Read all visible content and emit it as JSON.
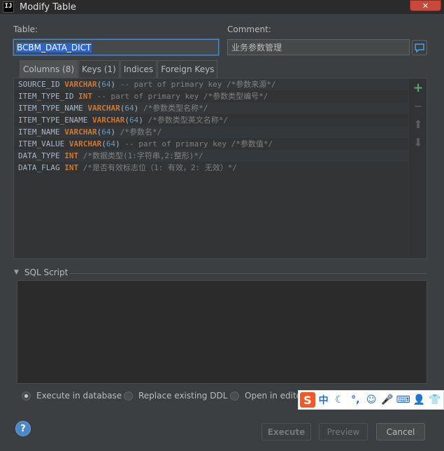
{
  "window": {
    "title": "Modify Table",
    "app_icon": "IJ",
    "close_glyph": "✕"
  },
  "table": {
    "label": "Table:",
    "value": "BCBM_DATA_DICT"
  },
  "comment": {
    "label": "Comment:",
    "value": "业务参数管理"
  },
  "tabs": [
    {
      "label": "Columns (8)"
    },
    {
      "label": "Keys (1)"
    },
    {
      "label": "Indices"
    },
    {
      "label": "Foreign Keys"
    }
  ],
  "columns": [
    {
      "name": "SOURCE_ID",
      "type": "VARCHAR",
      "size": "64",
      "extra": "-- part of primary key",
      "comment": "/*参数来源*/"
    },
    {
      "name": "ITEM_TYPE_ID",
      "type": "INT",
      "size": "",
      "extra": "-- part of primary key",
      "comment": "/*参数类型编号*/"
    },
    {
      "name": "ITEM_TYPE_NAME",
      "type": "VARCHAR",
      "size": "64",
      "extra": "",
      "comment": "/*参数类型名称*/"
    },
    {
      "name": "ITEM_TYPE_ENAME",
      "type": "VARCHAR",
      "size": "64",
      "extra": "",
      "comment": "/*参数类型英文名称*/"
    },
    {
      "name": "ITEM_NAME",
      "type": "VARCHAR",
      "size": "64",
      "extra": "",
      "comment": "/*参数名*/"
    },
    {
      "name": "ITEM_VALUE",
      "type": "VARCHAR",
      "size": "64",
      "extra": "-- part of primary key",
      "comment": "/*参数值*/"
    },
    {
      "name": "DATA_TYPE",
      "type": "INT",
      "size": "",
      "extra": "",
      "comment": "/*数据类型(1:字符串,2:整形)*/"
    },
    {
      "name": "DATA_FLAG",
      "type": "INT",
      "size": "",
      "extra": "",
      "comment": "/*是否有效标志位（1: 有效，2: 无效）*/"
    }
  ],
  "side_tools": {
    "add": "+",
    "remove": "−",
    "up": "⬆",
    "down": "⬇"
  },
  "sql": {
    "label": "SQL Script",
    "toggle": "▼"
  },
  "options": [
    {
      "label": "Execute in database",
      "selected": true
    },
    {
      "label": "Replace existing DDL",
      "selected": false
    },
    {
      "label": "Open in editor:",
      "selected": false
    }
  ],
  "ime": {
    "logo": "S",
    "lang": "中",
    "moon": "☾",
    "punct": "°,",
    "emoji": "☺",
    "mic": "🎤",
    "keyboard": "⌨",
    "user": "👤",
    "shirt": "👕"
  },
  "help": "?",
  "buttons": {
    "execute": "Execute",
    "preview": "Preview",
    "cancel": "Cancel"
  },
  "colors": {
    "keyword": "#cc7832",
    "number": "#6897bb",
    "comment": "#808080",
    "selection": "#2f65ca",
    "add": "#59a869"
  }
}
